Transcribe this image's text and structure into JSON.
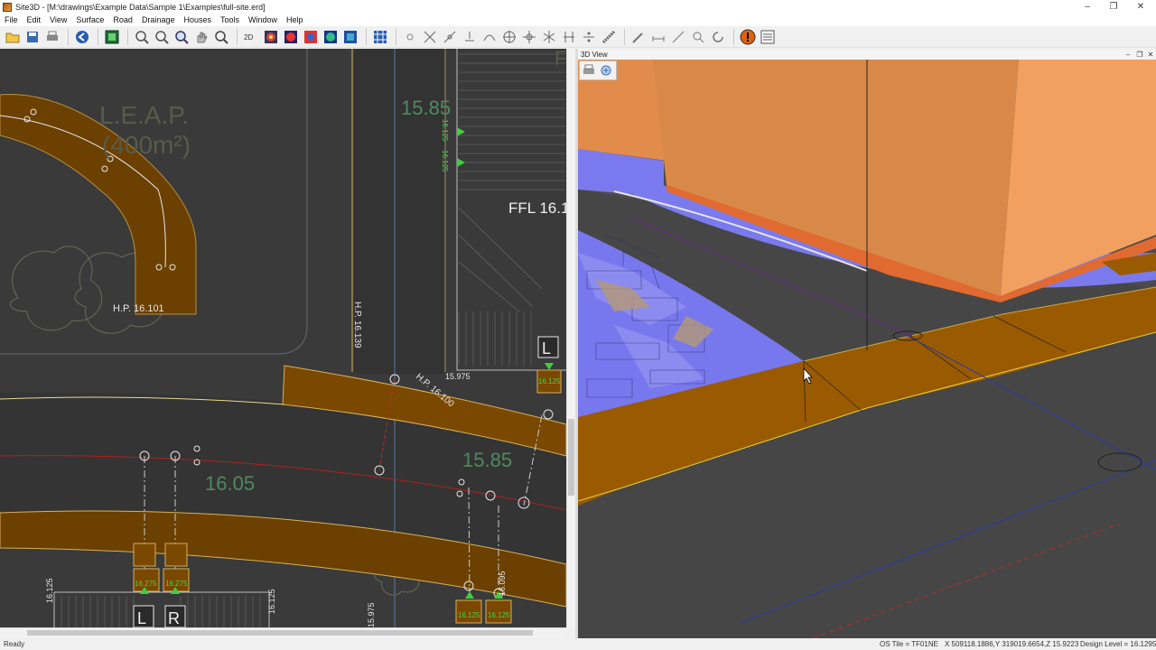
{
  "window": {
    "title": "Site3D - [M:\\drawings\\Example Data\\Sample 1\\Examples\\full-site.erd]",
    "controls": [
      "–",
      "❐",
      "✕"
    ]
  },
  "menu": [
    "File",
    "Edit",
    "View",
    "Surface",
    "Road",
    "Drainage",
    "Houses",
    "Tools",
    "Window",
    "Help"
  ],
  "plan": {
    "labels": {
      "leap_line1": "L.E.A.P.",
      "leap_line2": "(400m²)",
      "hp_1": "H.P. 16.101",
      "hp_2": "H.P. 16.139",
      "hp_3": "H.P. 16.100",
      "level_top": "15.85",
      "level_mid": "15.85",
      "level_left": "16.05",
      "level_small": "15.975",
      "ffl": "FFL 16.1",
      "vert_125a": "16.125",
      "vert_125b": "16.125",
      "vert_125c": "16.125",
      "vert_125d": "16.125",
      "vert_095": "16.095",
      "vert_975": "15.975",
      "p_1": "16.125",
      "p_2": "16.275",
      "p_3": "16.275",
      "p_4": "16.125",
      "p_5": "16.125",
      "box_L": "L",
      "box_L2": "L",
      "box_R": "R",
      "corner_p": "F"
    }
  },
  "view3d": {
    "title": "3D View",
    "controls": [
      "–",
      "❐",
      "✕"
    ]
  },
  "status": {
    "ready": "Ready",
    "os_tile": "OS Tile = TF01NE",
    "coords": "X 509118.1886,Y 319019.6654,Z 15.9223",
    "design_level": "Design Level = 16.1295"
  },
  "colors": {
    "kerb_brown": "#8a5200",
    "road_brown": "#6b4000",
    "building_orange": "#e8914d",
    "paving_blue": "#7b7bf0",
    "cad_dark": "#3a3a3a",
    "level_green": "#4caf50"
  }
}
